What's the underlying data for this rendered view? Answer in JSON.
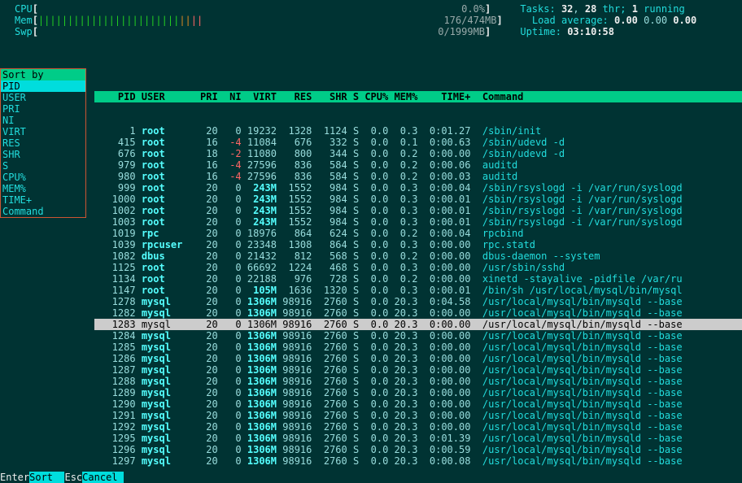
{
  "meters": {
    "cpu_label": "CPU",
    "cpu_pct": "0.0%",
    "mem_label": "Mem",
    "mem_used": "176",
    "mem_total": "474MB",
    "swp_label": "Swp",
    "swp_used": "0",
    "swp_total": "1999MB"
  },
  "stats": {
    "tasks_label": "Tasks:",
    "tasks_count": "32",
    "thr_count": "28",
    "thr_label": "thr;",
    "running_count": "1",
    "running_label": "running",
    "la_label": "Load average:",
    "la1": "0.00",
    "la2": "0.00",
    "la3": "0.00",
    "uptime_label": "Uptime:",
    "uptime": "03:10:58"
  },
  "sort": {
    "title": "Sort by",
    "selected": "PID",
    "items": [
      "USER",
      "PRI",
      "NI",
      "VIRT",
      "RES",
      "SHR",
      "S",
      "CPU%",
      "MEM%",
      "TIME+",
      "Command"
    ]
  },
  "columns": [
    "PID",
    "USER",
    "PRI",
    "NI",
    "VIRT",
    "RES",
    "SHR",
    "S",
    "CPU%",
    "MEM%",
    "TIME+",
    "Command"
  ],
  "rows": [
    {
      "pid": "1",
      "user": "root",
      "pri": "20",
      "ni": "0",
      "virt": "19232",
      "res": "1328",
      "shr": "1124",
      "s": "S",
      "cpu": "0.0",
      "mem": "0.3",
      "time": "0:01.27",
      "cmd": "/sbin/init"
    },
    {
      "pid": "415",
      "user": "root",
      "pri": "16",
      "ni": "-4",
      "virt": "11084",
      "res": "676",
      "shr": "332",
      "s": "S",
      "cpu": "0.0",
      "mem": "0.1",
      "time": "0:00.63",
      "cmd": "/sbin/udevd -d"
    },
    {
      "pid": "676",
      "user": "root",
      "pri": "18",
      "ni": "-2",
      "virt": "11080",
      "res": "800",
      "shr": "344",
      "s": "S",
      "cpu": "0.0",
      "mem": "0.2",
      "time": "0:00.00",
      "cmd": "/sbin/udevd -d"
    },
    {
      "pid": "979",
      "user": "root",
      "pri": "16",
      "ni": "-4",
      "virt": "27596",
      "res": "836",
      "shr": "584",
      "s": "S",
      "cpu": "0.0",
      "mem": "0.2",
      "time": "0:00.06",
      "cmd": "auditd"
    },
    {
      "pid": "980",
      "user": "root",
      "pri": "16",
      "ni": "-4",
      "virt": "27596",
      "res": "836",
      "shr": "584",
      "s": "S",
      "cpu": "0.0",
      "mem": "0.2",
      "time": "0:00.03",
      "cmd": "auditd"
    },
    {
      "pid": "999",
      "user": "root",
      "pri": "20",
      "ni": "0",
      "virt": "243M",
      "res": "1552",
      "shr": "984",
      "s": "S",
      "cpu": "0.0",
      "mem": "0.3",
      "time": "0:00.04",
      "cmd": "/sbin/rsyslogd -i /var/run/syslogd"
    },
    {
      "pid": "1000",
      "user": "root",
      "pri": "20",
      "ni": "0",
      "virt": "243M",
      "res": "1552",
      "shr": "984",
      "s": "S",
      "cpu": "0.0",
      "mem": "0.3",
      "time": "0:00.01",
      "cmd": "/sbin/rsyslogd -i /var/run/syslogd"
    },
    {
      "pid": "1002",
      "user": "root",
      "pri": "20",
      "ni": "0",
      "virt": "243M",
      "res": "1552",
      "shr": "984",
      "s": "S",
      "cpu": "0.0",
      "mem": "0.3",
      "time": "0:00.01",
      "cmd": "/sbin/rsyslogd -i /var/run/syslogd"
    },
    {
      "pid": "1003",
      "user": "root",
      "pri": "20",
      "ni": "0",
      "virt": "243M",
      "res": "1552",
      "shr": "984",
      "s": "S",
      "cpu": "0.0",
      "mem": "0.3",
      "time": "0:00.01",
      "cmd": "/sbin/rsyslogd -i /var/run/syslogd"
    },
    {
      "pid": "1019",
      "user": "rpc",
      "pri": "20",
      "ni": "0",
      "virt": "18976",
      "res": "864",
      "shr": "624",
      "s": "S",
      "cpu": "0.0",
      "mem": "0.2",
      "time": "0:00.04",
      "cmd": "rpcbind"
    },
    {
      "pid": "1039",
      "user": "rpcuser",
      "pri": "20",
      "ni": "0",
      "virt": "23348",
      "res": "1308",
      "shr": "864",
      "s": "S",
      "cpu": "0.0",
      "mem": "0.3",
      "time": "0:00.00",
      "cmd": "rpc.statd"
    },
    {
      "pid": "1082",
      "user": "dbus",
      "pri": "20",
      "ni": "0",
      "virt": "21432",
      "res": "812",
      "shr": "568",
      "s": "S",
      "cpu": "0.0",
      "mem": "0.2",
      "time": "0:00.00",
      "cmd": "dbus-daemon --system"
    },
    {
      "pid": "1125",
      "user": "root",
      "pri": "20",
      "ni": "0",
      "virt": "66692",
      "res": "1224",
      "shr": "468",
      "s": "S",
      "cpu": "0.0",
      "mem": "0.3",
      "time": "0:00.00",
      "cmd": "/usr/sbin/sshd"
    },
    {
      "pid": "1134",
      "user": "root",
      "pri": "20",
      "ni": "0",
      "virt": "22188",
      "res": "976",
      "shr": "728",
      "s": "S",
      "cpu": "0.0",
      "mem": "0.2",
      "time": "0:00.00",
      "cmd": "xinetd -stayalive -pidfile /var/ru"
    },
    {
      "pid": "1147",
      "user": "root",
      "pri": "20",
      "ni": "0",
      "virt": "105M",
      "res": "1636",
      "shr": "1320",
      "s": "S",
      "cpu": "0.0",
      "mem": "0.3",
      "time": "0:00.01",
      "cmd": "/bin/sh /usr/local/mysql/bin/mysql"
    },
    {
      "pid": "1278",
      "user": "mysql",
      "pri": "20",
      "ni": "0",
      "virt": "1306M",
      "res": "98916",
      "shr": "2760",
      "s": "S",
      "cpu": "0.0",
      "mem": "20.3",
      "time": "0:04.58",
      "cmd": "/usr/local/mysql/bin/mysqld --base"
    },
    {
      "pid": "1282",
      "user": "mysql",
      "pri": "20",
      "ni": "0",
      "virt": "1306M",
      "res": "98916",
      "shr": "2760",
      "s": "S",
      "cpu": "0.0",
      "mem": "20.3",
      "time": "0:00.00",
      "cmd": "/usr/local/mysql/bin/mysqld --base"
    },
    {
      "pid": "1283",
      "user": "mysql",
      "pri": "20",
      "ni": "0",
      "virt": "1306M",
      "res": "98916",
      "shr": "2760",
      "s": "S",
      "cpu": "0.0",
      "mem": "20.3",
      "time": "0:00.00",
      "cmd": "/usr/local/mysql/bin/mysqld --base",
      "sel": true
    },
    {
      "pid": "1284",
      "user": "mysql",
      "pri": "20",
      "ni": "0",
      "virt": "1306M",
      "res": "98916",
      "shr": "2760",
      "s": "S",
      "cpu": "0.0",
      "mem": "20.3",
      "time": "0:00.00",
      "cmd": "/usr/local/mysql/bin/mysqld --base"
    },
    {
      "pid": "1285",
      "user": "mysql",
      "pri": "20",
      "ni": "0",
      "virt": "1306M",
      "res": "98916",
      "shr": "2760",
      "s": "S",
      "cpu": "0.0",
      "mem": "20.3",
      "time": "0:00.00",
      "cmd": "/usr/local/mysql/bin/mysqld --base"
    },
    {
      "pid": "1286",
      "user": "mysql",
      "pri": "20",
      "ni": "0",
      "virt": "1306M",
      "res": "98916",
      "shr": "2760",
      "s": "S",
      "cpu": "0.0",
      "mem": "20.3",
      "time": "0:00.00",
      "cmd": "/usr/local/mysql/bin/mysqld --base"
    },
    {
      "pid": "1287",
      "user": "mysql",
      "pri": "20",
      "ni": "0",
      "virt": "1306M",
      "res": "98916",
      "shr": "2760",
      "s": "S",
      "cpu": "0.0",
      "mem": "20.3",
      "time": "0:00.00",
      "cmd": "/usr/local/mysql/bin/mysqld --base"
    },
    {
      "pid": "1288",
      "user": "mysql",
      "pri": "20",
      "ni": "0",
      "virt": "1306M",
      "res": "98916",
      "shr": "2760",
      "s": "S",
      "cpu": "0.0",
      "mem": "20.3",
      "time": "0:00.00",
      "cmd": "/usr/local/mysql/bin/mysqld --base"
    },
    {
      "pid": "1289",
      "user": "mysql",
      "pri": "20",
      "ni": "0",
      "virt": "1306M",
      "res": "98916",
      "shr": "2760",
      "s": "S",
      "cpu": "0.0",
      "mem": "20.3",
      "time": "0:00.00",
      "cmd": "/usr/local/mysql/bin/mysqld --base"
    },
    {
      "pid": "1290",
      "user": "mysql",
      "pri": "20",
      "ni": "0",
      "virt": "1306M",
      "res": "98916",
      "shr": "2760",
      "s": "S",
      "cpu": "0.0",
      "mem": "20.3",
      "time": "0:00.00",
      "cmd": "/usr/local/mysql/bin/mysqld --base"
    },
    {
      "pid": "1291",
      "user": "mysql",
      "pri": "20",
      "ni": "0",
      "virt": "1306M",
      "res": "98916",
      "shr": "2760",
      "s": "S",
      "cpu": "0.0",
      "mem": "20.3",
      "time": "0:00.00",
      "cmd": "/usr/local/mysql/bin/mysqld --base"
    },
    {
      "pid": "1292",
      "user": "mysql",
      "pri": "20",
      "ni": "0",
      "virt": "1306M",
      "res": "98916",
      "shr": "2760",
      "s": "S",
      "cpu": "0.0",
      "mem": "20.3",
      "time": "0:00.00",
      "cmd": "/usr/local/mysql/bin/mysqld --base"
    },
    {
      "pid": "1295",
      "user": "mysql",
      "pri": "20",
      "ni": "0",
      "virt": "1306M",
      "res": "98916",
      "shr": "2760",
      "s": "S",
      "cpu": "0.0",
      "mem": "20.3",
      "time": "0:01.39",
      "cmd": "/usr/local/mysql/bin/mysqld --base"
    },
    {
      "pid": "1296",
      "user": "mysql",
      "pri": "20",
      "ni": "0",
      "virt": "1306M",
      "res": "98916",
      "shr": "2760",
      "s": "S",
      "cpu": "0.0",
      "mem": "20.3",
      "time": "0:00.59",
      "cmd": "/usr/local/mysql/bin/mysqld --base"
    },
    {
      "pid": "1297",
      "user": "mysql",
      "pri": "20",
      "ni": "0",
      "virt": "1306M",
      "res": "98916",
      "shr": "2760",
      "s": "S",
      "cpu": "0.0",
      "mem": "20.3",
      "time": "0:00.08",
      "cmd": "/usr/local/mysql/bin/mysqld --base"
    }
  ],
  "footer": {
    "k1": "Enter",
    "l1": "Sort  ",
    "k2": "Esc",
    "l2": "Cancel "
  }
}
